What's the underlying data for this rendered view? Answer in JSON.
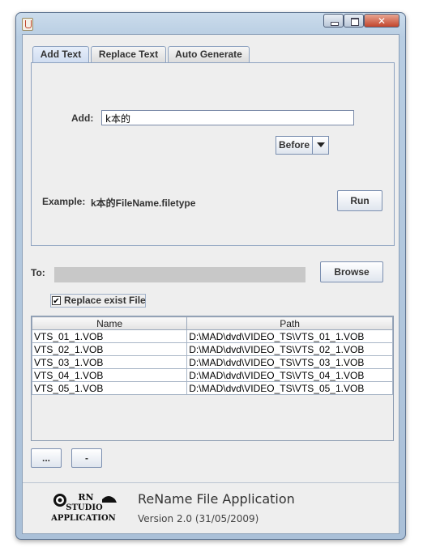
{
  "window": {
    "icon": "java-coffee-icon",
    "controls": [
      "minimize-icon",
      "maximize-icon",
      "close-icon"
    ]
  },
  "tabs": [
    {
      "label": "Add Text",
      "active": true
    },
    {
      "label": "Replace Text",
      "active": false
    },
    {
      "label": "Auto Generate",
      "active": false
    }
  ],
  "add_panel": {
    "add_label": "Add:",
    "add_value": "k本的",
    "position_selected": "Before",
    "example_label": "Example:",
    "example_value": "k本的FileName.filetype",
    "run_label": "Run"
  },
  "destination": {
    "to_label": "To:",
    "to_value": "",
    "browse_label": "Browse"
  },
  "options": {
    "replace_exist_label": "Replace exist File",
    "replace_exist_checked": true
  },
  "file_table": {
    "columns": [
      "Name",
      "Path"
    ],
    "rows": [
      [
        "VTS_01_1.VOB",
        "D:\\MAD\\dvd\\VIDEO_TS\\VTS_01_1.VOB"
      ],
      [
        "VTS_02_1.VOB",
        "D:\\MAD\\dvd\\VIDEO_TS\\VTS_02_1.VOB"
      ],
      [
        "VTS_03_1.VOB",
        "D:\\MAD\\dvd\\VIDEO_TS\\VTS_03_1.VOB"
      ],
      [
        "VTS_04_1.VOB",
        "D:\\MAD\\dvd\\VIDEO_TS\\VTS_04_1.VOB"
      ],
      [
        "VTS_05_1.VOB",
        "D:\\MAD\\dvd\\VIDEO_TS\\VTS_05_1.VOB"
      ]
    ]
  },
  "list_buttons": {
    "add_label": "...",
    "remove_label": "-"
  },
  "footer": {
    "logo_lines": [
      "RN",
      "STUDIO",
      "APPLICATION"
    ],
    "app_title": "ReName File Application",
    "version": "Version 2.0 (31/05/2009)"
  },
  "colors": {
    "frame": "#b8cde2",
    "panel_bg": "#eeeeee",
    "tab_border": "#8da2c0",
    "close_button": "#c2452d"
  }
}
